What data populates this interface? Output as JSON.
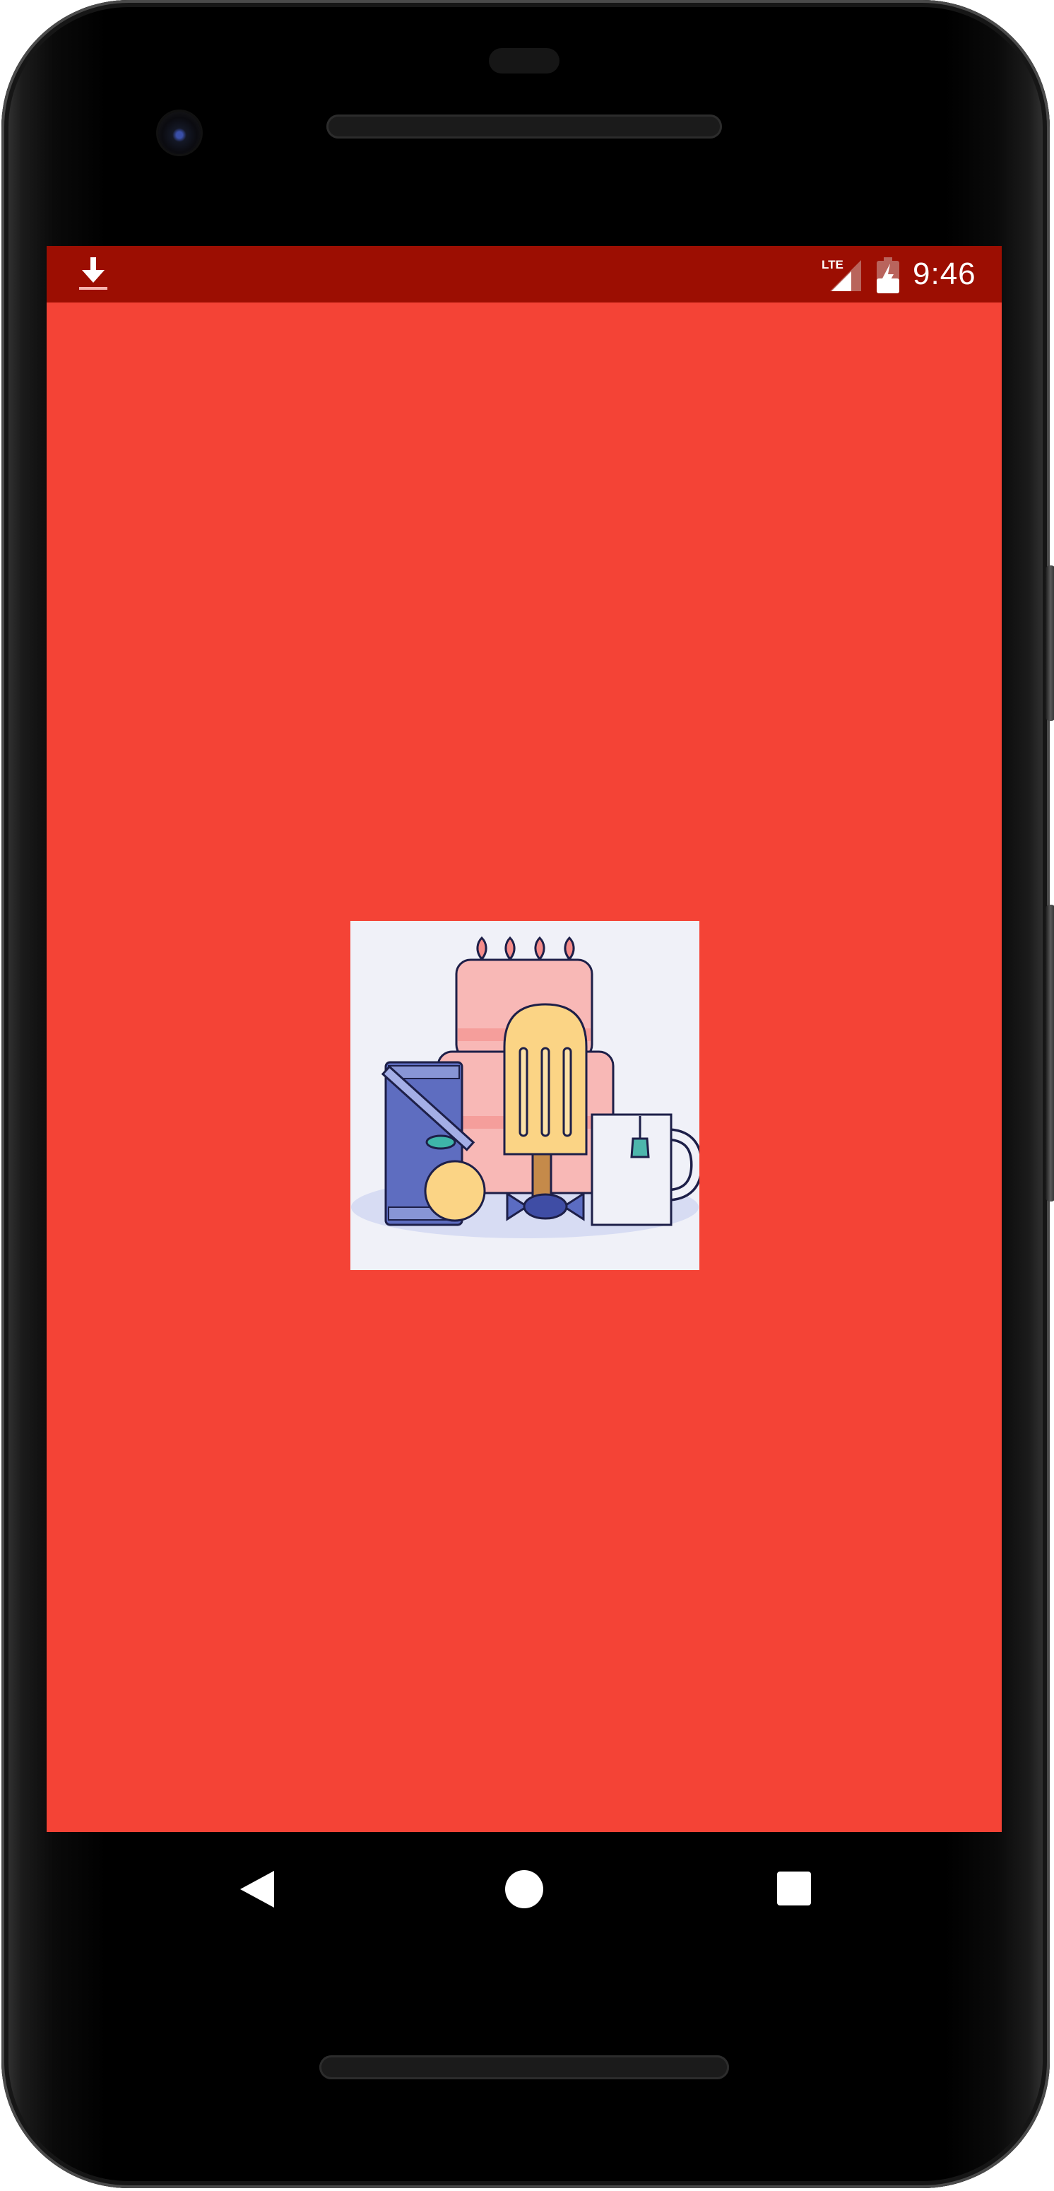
{
  "status_bar": {
    "time": "9:46",
    "network_label": "LTE",
    "background_color": "#9C0E02",
    "icons": [
      "download-icon",
      "lte-signal-icon",
      "battery-charging-icon"
    ]
  },
  "screen": {
    "background_color": "#F44336",
    "splash_icon": "food-and-drinks-illustration"
  },
  "nav_bar": {
    "buttons": [
      "back",
      "home",
      "recents"
    ]
  }
}
